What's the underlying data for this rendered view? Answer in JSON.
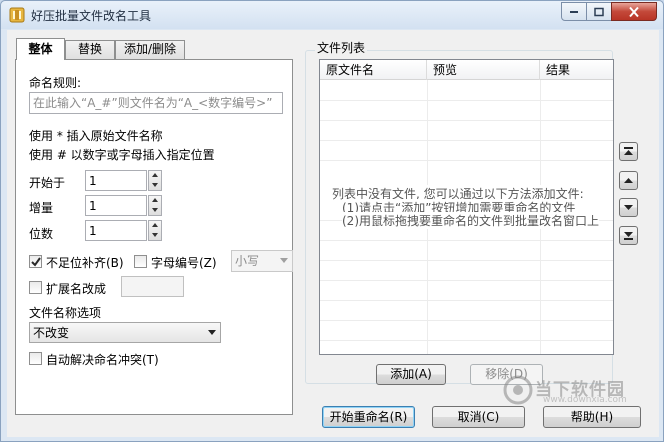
{
  "window": {
    "title": "好压批量文件改名工具"
  },
  "tabs": [
    {
      "label": "整体",
      "active": true
    },
    {
      "label": "替换",
      "active": false
    },
    {
      "label": "添加/删除",
      "active": false
    }
  ],
  "rules": {
    "naming_label": "命名规则:",
    "naming_placeholder": "在此输入“A_#”则文件名为“A_<数字编号>”",
    "hint_star": "使用 * 插入原始文件名称",
    "hint_hash": "使用 # 以数字或字母插入指定位置",
    "start_label": "开始于",
    "start_value": "1",
    "step_label": "增量",
    "step_value": "1",
    "digits_label": "位数",
    "digits_value": "1",
    "pad_label": "不足位补齐(B)",
    "pad_checked": true,
    "letter_label": "字母编号(Z)",
    "letter_checked": false,
    "case_value": "小写",
    "ext_label": "扩展名改成",
    "ext_checked": false,
    "ext_value": "",
    "filename_option_label": "文件名称选项",
    "filename_option_value": "不改变",
    "auto_resolve_label": "自动解决命名冲突(T)",
    "auto_resolve_checked": false
  },
  "file_list": {
    "group_title": "文件列表",
    "columns": [
      "原文件名",
      "预览",
      "结果"
    ],
    "empty_line1": "列表中没有文件, 您可以通过以下方法添加文件:",
    "empty_line2": "(1)请点击“添加”按钮增加需要重命名的文件",
    "empty_line3": "(2)用鼠标拖拽要重命名的文件到批量改名窗口上",
    "add_label": "添加(A)",
    "remove_label": "移除(D)"
  },
  "footer": {
    "start_label": "开始重命名(R)",
    "cancel_label": "取消(C)",
    "help_label": "帮助(H)"
  },
  "watermark": {
    "text": "当下软件园",
    "sub": "www.downxia.com"
  },
  "colors": {
    "title_bg": "#dce7f3",
    "close_red": "#c4493a",
    "accent": "#3c7fb1"
  }
}
